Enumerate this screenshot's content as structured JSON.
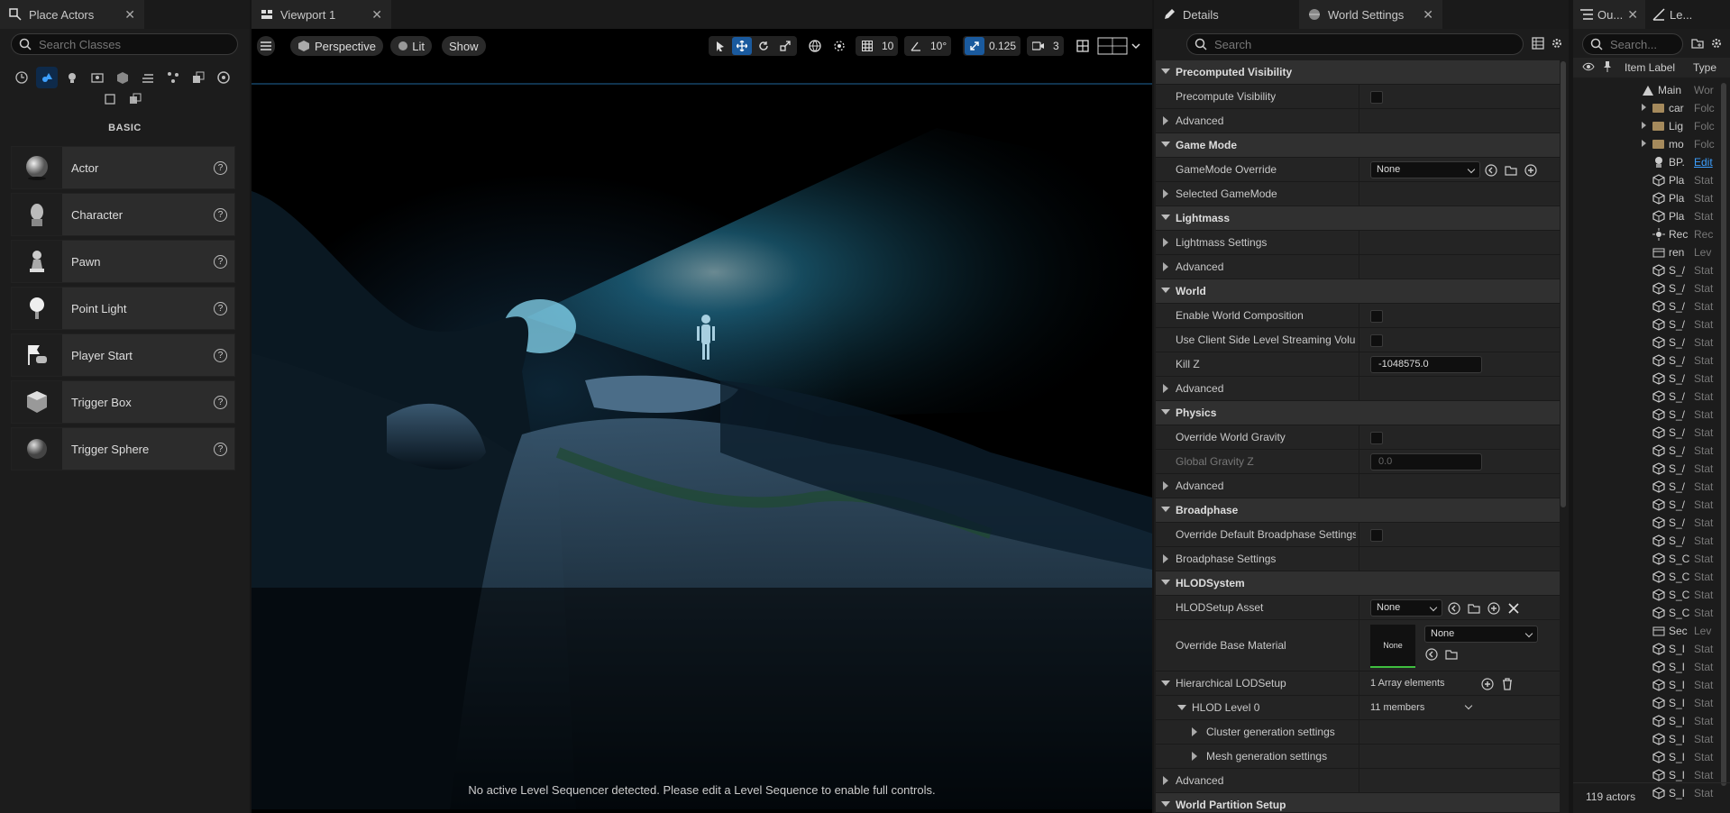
{
  "left_panel": {
    "tab_title": "Place Actors",
    "search_placeholder": "Search Classes",
    "category_label": "BASIC",
    "categories": [
      "recent-icon",
      "basic-icon",
      "lights-icon",
      "cinematic-icon",
      "visual-effects-icon",
      "geometry-icon",
      "volumes-icon",
      "all-classes-icon",
      "shapes-icon",
      "custom-icon",
      "extra-icon"
    ],
    "items": [
      {
        "label": "Actor",
        "icon": "sphere-icon"
      },
      {
        "label": "Character",
        "icon": "character-icon"
      },
      {
        "label": "Pawn",
        "icon": "pawn-icon"
      },
      {
        "label": "Point Light",
        "icon": "point-light-icon"
      },
      {
        "label": "Player Start",
        "icon": "player-start-icon"
      },
      {
        "label": "Trigger Box",
        "icon": "trigger-box-icon"
      },
      {
        "label": "Trigger Sphere",
        "icon": "trigger-sphere-icon"
      }
    ]
  },
  "viewport": {
    "tab_title": "Viewport 1",
    "perspective_label": "Perspective",
    "lit_label": "Lit",
    "show_label": "Show",
    "grid_snap": "10",
    "rotation_snap": "10°",
    "scale_snap": "0.125",
    "camera_speed": "3",
    "message": "No active Level Sequencer detected. Please edit a Level Sequence to enable full controls."
  },
  "details": {
    "tabs": [
      {
        "label": "Details"
      },
      {
        "label": "World Settings"
      }
    ],
    "search_placeholder": "Search",
    "rows": {
      "precomputed_visibility": "Precomputed Visibility",
      "precompute_visibility": "Precompute Visibility",
      "advanced": "Advanced",
      "game_mode": "Game Mode",
      "gamemode_override": "GameMode Override",
      "gamemode_value": "None",
      "selected_gamemode": "Selected GameMode",
      "lightmass": "Lightmass",
      "lightmass_settings": "Lightmass Settings",
      "world": "World",
      "enable_world_composition": "Enable World Composition",
      "use_client_side": "Use Client Side Level Streaming Volu...",
      "kill_z": "Kill Z",
      "kill_z_value": "-1048575.0",
      "physics": "Physics",
      "override_world_gravity": "Override World Gravity",
      "global_gravity_z": "Global Gravity Z",
      "global_gravity_value": "0.0",
      "broadphase": "Broadphase",
      "override_broadphase": "Override Default Broadphase Settings",
      "broadphase_settings": "Broadphase Settings",
      "hlod_system": "HLODSystem",
      "hlod_setup_asset": "HLODSetup Asset",
      "hlod_setup_value": "None",
      "override_base_material": "Override Base Material",
      "material_thumb_label": "None",
      "material_value": "None",
      "hierarchical_lod_setup": "Hierarchical LODSetup",
      "array_elements": "1 Array elements",
      "hlod_level_0": "HLOD Level 0",
      "members": "11 members",
      "cluster_generation": "Cluster generation settings",
      "mesh_generation": "Mesh generation settings",
      "world_partition_setup": "World Partition Setup"
    }
  },
  "outliner": {
    "tab_title": "Ou...",
    "tab2_title": "Le...",
    "search_placeholder": "Search...",
    "col_item_label": "Item Label",
    "col_type": "Type",
    "rows": [
      {
        "label": "Main",
        "type": "Wor",
        "kind": "world"
      },
      {
        "label": "car",
        "type": "Folc",
        "kind": "folder"
      },
      {
        "label": "Lig",
        "type": "Folc",
        "kind": "folder"
      },
      {
        "label": "mo",
        "type": "Folc",
        "kind": "folder"
      },
      {
        "label": "BP.",
        "type": "Edit",
        "kind": "bp"
      },
      {
        "label": "Pla",
        "type": "Stat",
        "kind": "mesh"
      },
      {
        "label": "Pla",
        "type": "Stat",
        "kind": "mesh"
      },
      {
        "label": "Pla",
        "type": "Stat",
        "kind": "mesh"
      },
      {
        "label": "Rec",
        "type": "Rec",
        "kind": "light"
      },
      {
        "label": "ren",
        "type": "Lev",
        "kind": "level"
      },
      {
        "label": "S_/",
        "type": "Stat",
        "kind": "mesh"
      },
      {
        "label": "S_/",
        "type": "Stat",
        "kind": "mesh"
      },
      {
        "label": "S_/",
        "type": "Stat",
        "kind": "mesh"
      },
      {
        "label": "S_/",
        "type": "Stat",
        "kind": "mesh"
      },
      {
        "label": "S_/",
        "type": "Stat",
        "kind": "mesh"
      },
      {
        "label": "S_/",
        "type": "Stat",
        "kind": "mesh"
      },
      {
        "label": "S_/",
        "type": "Stat",
        "kind": "mesh"
      },
      {
        "label": "S_/",
        "type": "Stat",
        "kind": "mesh"
      },
      {
        "label": "S_/",
        "type": "Stat",
        "kind": "mesh"
      },
      {
        "label": "S_/",
        "type": "Stat",
        "kind": "mesh"
      },
      {
        "label": "S_/",
        "type": "Stat",
        "kind": "mesh"
      },
      {
        "label": "S_/",
        "type": "Stat",
        "kind": "mesh"
      },
      {
        "label": "S_/",
        "type": "Stat",
        "kind": "mesh"
      },
      {
        "label": "S_/",
        "type": "Stat",
        "kind": "mesh"
      },
      {
        "label": "S_/",
        "type": "Stat",
        "kind": "mesh"
      },
      {
        "label": "S_/",
        "type": "Stat",
        "kind": "mesh"
      },
      {
        "label": "S_C",
        "type": "Stat",
        "kind": "mesh"
      },
      {
        "label": "S_C",
        "type": "Stat",
        "kind": "mesh"
      },
      {
        "label": "S_C",
        "type": "Stat",
        "kind": "mesh"
      },
      {
        "label": "S_C",
        "type": "Stat",
        "kind": "mesh"
      },
      {
        "label": "Sec",
        "type": "Lev",
        "kind": "level"
      },
      {
        "label": "S_I",
        "type": "Stat",
        "kind": "mesh"
      },
      {
        "label": "S_I",
        "type": "Stat",
        "kind": "mesh"
      },
      {
        "label": "S_I",
        "type": "Stat",
        "kind": "mesh"
      },
      {
        "label": "S_I",
        "type": "Stat",
        "kind": "mesh"
      },
      {
        "label": "S_I",
        "type": "Stat",
        "kind": "mesh"
      },
      {
        "label": "S_I",
        "type": "Stat",
        "kind": "mesh"
      },
      {
        "label": "S_I",
        "type": "Stat",
        "kind": "mesh"
      },
      {
        "label": "S_I",
        "type": "Stat",
        "kind": "mesh"
      },
      {
        "label": "S_I",
        "type": "Stat",
        "kind": "mesh"
      }
    ],
    "footer": "119 actors"
  },
  "colors": {
    "accent": "#1a5a9e",
    "selected_cat": "#3da0ff"
  }
}
